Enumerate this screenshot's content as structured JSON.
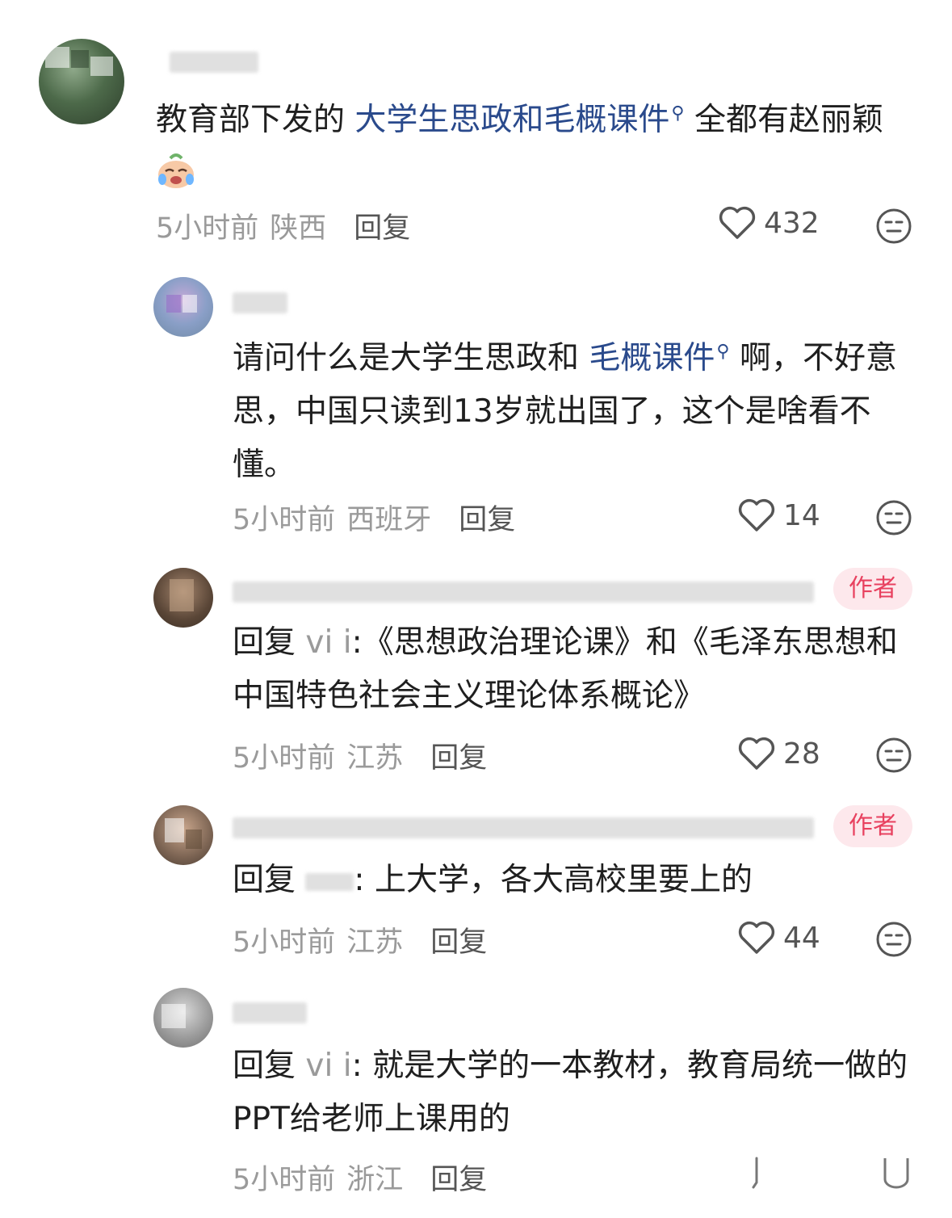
{
  "comments": [
    {
      "username": "",
      "text_parts": [
        "教育部下发的 ",
        "大学生思政和毛概课件",
        " 全都有赵丽颖"
      ],
      "time": "5小时前",
      "location": "陕西",
      "reply_label": "回复",
      "likes": "432"
    },
    {
      "username": "",
      "text_parts": [
        "请问什么是大学生思政和 ",
        "毛概课件",
        " 啊，不好意思，中国只读到13岁就出国了，这个是啥看不懂。"
      ],
      "time": "5小时前",
      "location": "西班牙",
      "reply_label": "回复",
      "likes": "14"
    },
    {
      "username": "",
      "badge": "作者",
      "reply_prefix": "回复",
      "reply_to": "vi i",
      "text": ":《思想政治理论课》和《毛泽东思想和中国特色社会主义理论体系概论》",
      "time": "5小时前",
      "location": "江苏",
      "reply_label": "回复",
      "likes": "28"
    },
    {
      "username": "",
      "badge": "作者",
      "reply_prefix": "回复",
      "reply_to": "",
      "text": ": 上大学，各大高校里要上的",
      "time": "5小时前",
      "location": "江苏",
      "reply_label": "回复",
      "likes": "44"
    },
    {
      "username": "",
      "reply_prefix": "回复",
      "reply_to": "vi i",
      "text": ": 就是大学的一本教材，教育局统一做的PPT给老师上课用的",
      "time": "5小时前",
      "location": "浙江",
      "reply_label": "回复"
    }
  ],
  "icons": {
    "like": "heart-outline-icon",
    "react": "meh-face-icon",
    "search": "search-icon",
    "emoji": "crying-laughing-emoji"
  },
  "colors": {
    "link": "#2a4a8c",
    "badge_text": "#e8415f",
    "badge_bg": "#fde8ec",
    "meta": "#9a9a9a"
  }
}
